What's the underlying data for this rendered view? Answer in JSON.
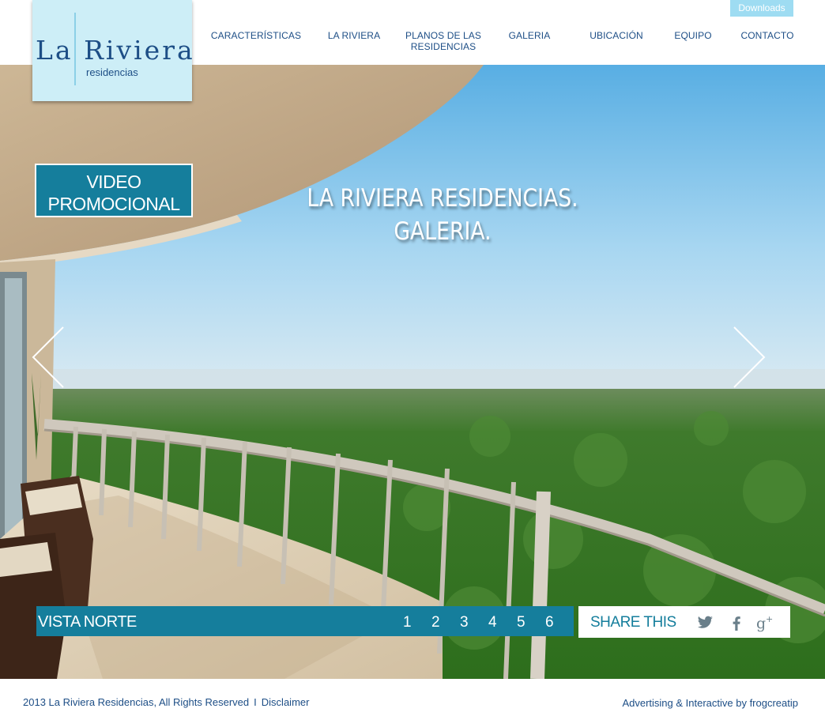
{
  "header": {
    "downloads_label": "Downloads",
    "nav": [
      {
        "label": "CARACTERÍSTICAS"
      },
      {
        "label": "LA RIVIERA"
      },
      {
        "label": "PLANOS DE LAS RESIDENCIAS"
      },
      {
        "label": "GALERIA"
      },
      {
        "label": "UBICACIÓN"
      },
      {
        "label": "EQUIPO"
      },
      {
        "label": "CONTACTO"
      }
    ]
  },
  "logo": {
    "name": "La Riviera",
    "subtitle": "residencias"
  },
  "hero": {
    "title_line1": "LA RIVIERA RESIDENCIAS.",
    "title_line2": "GALERIA.",
    "video_line1": "VIDEO",
    "video_line2": "PROMOCIONAL",
    "prev_icon": "chevron-left-icon",
    "next_icon": "chevron-right-icon"
  },
  "gallery": {
    "caption": "VISTA NORTE",
    "pages": [
      "1",
      "2",
      "3",
      "4",
      "5",
      "6"
    ]
  },
  "share": {
    "label": "SHARE THIS",
    "icons": [
      "twitter-icon",
      "facebook-icon",
      "google-plus-icon"
    ]
  },
  "footer": {
    "copyright": "2013 La Riviera Residencias, All Rights Reserved",
    "separator": "I",
    "disclaimer": "Disclaimer",
    "credit": "Advertising & Interactive by frogcreatip"
  },
  "colors": {
    "brand_blue": "#1d4e86",
    "accent_teal": "#157e9c",
    "logo_bg": "#cdeef7",
    "downloads_bg": "#9edcf2"
  }
}
